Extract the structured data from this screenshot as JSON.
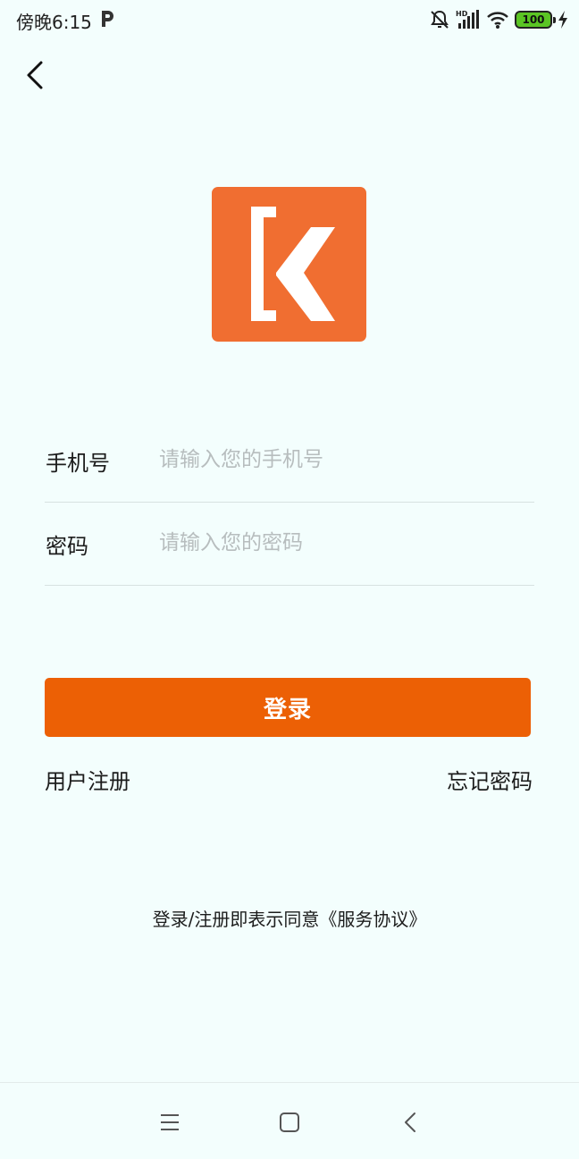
{
  "status_bar": {
    "time": "傍晚6:15",
    "network_label": "HD",
    "battery_level": "100"
  },
  "form": {
    "phone_label": "手机号",
    "phone_placeholder": "请输入您的手机号",
    "phone_value": "",
    "password_label": "密码",
    "password_placeholder": "请输入您的密码",
    "password_value": ""
  },
  "actions": {
    "login_label": "登录",
    "register_label": "用户注册",
    "forgot_label": "忘记密码"
  },
  "agreement": {
    "text": "登录/注册即表示同意《服务协议》"
  },
  "colors": {
    "accent": "#EC6005",
    "logo_bg": "#F06E31",
    "background": "#F3FEFD",
    "placeholder": "#B7BDBE"
  },
  "icons": {
    "back": "chevron-left-icon",
    "logo": "app-logo-icon",
    "nav_menu": "menu-icon",
    "nav_home": "home-square-icon",
    "nav_back": "nav-back-icon"
  }
}
